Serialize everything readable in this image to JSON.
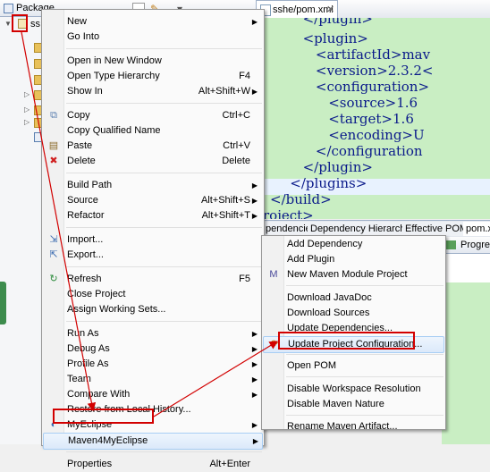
{
  "package_explorer": {
    "title": "Package Explorer",
    "tree_item": "ss"
  },
  "editor": {
    "tab_label": "sshe/pom.xml",
    "xml_lines": [
      "      </plugin>",
      "      <plugin>",
      "         <artifactId>mav",
      "         <version>2.3.2<",
      "         <configuration>",
      "            <source>1.6",
      "            <target>1.6",
      "            <encoding>U",
      "         </configuration",
      "      </plugin>",
      "   </plugins>",
      "</build>",
      "roject>"
    ],
    "bottom_tabs": [
      "pendencies",
      "Dependency Hierarchy",
      "Effective POM",
      "pom.x"
    ]
  },
  "progress_view": {
    "label": "Progres"
  },
  "context_menu": {
    "items": [
      {
        "label": "New",
        "submenu": true
      },
      {
        "label": "Go Into"
      },
      {
        "sep": true
      },
      {
        "label": "Open in New Window"
      },
      {
        "label": "Open Type Hierarchy",
        "shortcut": "F4"
      },
      {
        "label": "Show In",
        "shortcut": "Alt+Shift+W",
        "submenu": true
      },
      {
        "sep": true
      },
      {
        "label": "Copy",
        "shortcut": "Ctrl+C",
        "icon": "copy-icon"
      },
      {
        "label": "Copy Qualified Name"
      },
      {
        "label": "Paste",
        "shortcut": "Ctrl+V",
        "icon": "paste-icon"
      },
      {
        "label": "Delete",
        "shortcut": "Delete",
        "icon": "delete-icon"
      },
      {
        "sep": true
      },
      {
        "label": "Build Path",
        "submenu": true
      },
      {
        "label": "Source",
        "shortcut": "Alt+Shift+S",
        "submenu": true
      },
      {
        "label": "Refactor",
        "shortcut": "Alt+Shift+T",
        "submenu": true
      },
      {
        "sep": true
      },
      {
        "label": "Import...",
        "icon": "import-icon"
      },
      {
        "label": "Export...",
        "icon": "export-icon"
      },
      {
        "sep": true
      },
      {
        "label": "Refresh",
        "shortcut": "F5",
        "icon": "refresh-icon"
      },
      {
        "label": "Close Project"
      },
      {
        "label": "Assign Working Sets..."
      },
      {
        "sep": true
      },
      {
        "label": "Run As",
        "submenu": true
      },
      {
        "label": "Debug As",
        "submenu": true
      },
      {
        "label": "Profile As",
        "submenu": true
      },
      {
        "label": "Team",
        "submenu": true
      },
      {
        "label": "Compare With",
        "submenu": true
      },
      {
        "label": "Restore from Local History..."
      },
      {
        "label": "MyEclipse",
        "submenu": true,
        "icon": "myeclipse-icon"
      },
      {
        "label": "Maven4MyEclipse",
        "submenu": true,
        "selected": true
      },
      {
        "sep": true
      },
      {
        "label": "Properties",
        "shortcut": "Alt+Enter"
      }
    ]
  },
  "maven_submenu": {
    "items": [
      {
        "label": "Add Dependency"
      },
      {
        "label": "Add Plugin"
      },
      {
        "label": "New Maven Module Project",
        "icon": "maven-module-icon"
      },
      {
        "sep": true
      },
      {
        "label": "Download JavaDoc"
      },
      {
        "label": "Download Sources"
      },
      {
        "label": "Update Dependencies..."
      },
      {
        "label": "Update Project Configuration...",
        "icon": "update-config-icon",
        "selected": true
      },
      {
        "sep": true
      },
      {
        "label": "Open POM"
      },
      {
        "sep": true
      },
      {
        "label": "Disable Workspace Resolution"
      },
      {
        "label": "Disable Maven Nature"
      },
      {
        "sep": true
      },
      {
        "label": "Rename Maven Artifact..."
      }
    ]
  },
  "colors": {
    "annotation": "#d20000",
    "editor_bg": "#c9eec3",
    "xml_tag": "#0a1a8a"
  }
}
